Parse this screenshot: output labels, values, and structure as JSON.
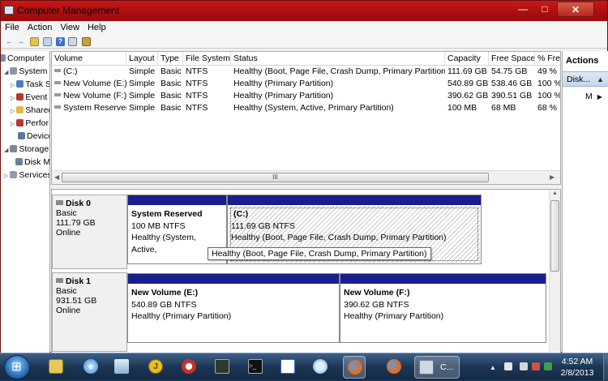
{
  "window": {
    "title": "Computer Management"
  },
  "menu": [
    "File",
    "Action",
    "View",
    "Help"
  ],
  "tree": [
    {
      "label": "Computer",
      "icon": "computer-icon"
    },
    {
      "label": "System T",
      "icon": "tools-icon"
    },
    {
      "label": "Task S",
      "icon": "task-scheduler-icon"
    },
    {
      "label": "Event",
      "icon": "event-viewer-icon"
    },
    {
      "label": "Shared",
      "icon": "shared-folder-icon"
    },
    {
      "label": "Perfor",
      "icon": "performance-icon"
    },
    {
      "label": "Device",
      "icon": "device-manager-icon"
    },
    {
      "label": "Storage",
      "icon": "storage-icon"
    },
    {
      "label": "Disk M",
      "icon": "disk-management-icon"
    },
    {
      "label": "Services",
      "icon": "services-icon"
    }
  ],
  "volume_list": {
    "headers": [
      "Volume",
      "Layout",
      "Type",
      "File System",
      "Status",
      "Capacity",
      "Free Space",
      "% Fre"
    ],
    "rows": [
      [
        "(C:)",
        "Simple",
        "Basic",
        "NTFS",
        "Healthy (Boot, Page File, Crash Dump, Primary Partition)",
        "111.69 GB",
        "54.75 GB",
        "49 %"
      ],
      [
        "New Volume (E:)",
        "Simple",
        "Basic",
        "NTFS",
        "Healthy (Primary Partition)",
        "540.89 GB",
        "538.46 GB",
        "100 %"
      ],
      [
        "New Volume (F:)",
        "Simple",
        "Basic",
        "NTFS",
        "Healthy (Primary Partition)",
        "390.62 GB",
        "390.51 GB",
        "100 %"
      ],
      [
        "System Reserved",
        "Simple",
        "Basic",
        "NTFS",
        "Healthy (System, Active, Primary Partition)",
        "100 MB",
        "68 MB",
        "68 %"
      ]
    ],
    "hscroll_grip": "III"
  },
  "disks": [
    {
      "name": "Disk 0",
      "kind": "Basic",
      "size": "111.79 GB",
      "state": "Online",
      "partitions": [
        {
          "name": "System Reserved",
          "size": "100 MB NTFS",
          "status": "Healthy (System, Active,"
        },
        {
          "name": "(C:)",
          "size": "111.69 GB NTFS",
          "status": "Healthy (Boot, Page File, Crash Dump, Primary Partition)"
        }
      ]
    },
    {
      "name": "Disk 1",
      "kind": "Basic",
      "size": "931.51 GB",
      "state": "Online",
      "partitions": [
        {
          "name": "New Volume  (E:)",
          "size": "540.89 GB NTFS",
          "status": "Healthy (Primary Partition)"
        },
        {
          "name": "New Volume  (F:)",
          "size": "390.62 GB NTFS",
          "status": "Healthy (Primary Partition)"
        }
      ]
    }
  ],
  "tooltip": "Healthy (Boot, Page File, Crash Dump, Primary Partition)",
  "actions": {
    "title": "Actions",
    "section": "Disk...",
    "item": "M"
  },
  "taskbar": {
    "active_label": "C...",
    "time": "4:52 AM",
    "date": "2/8/2013"
  }
}
